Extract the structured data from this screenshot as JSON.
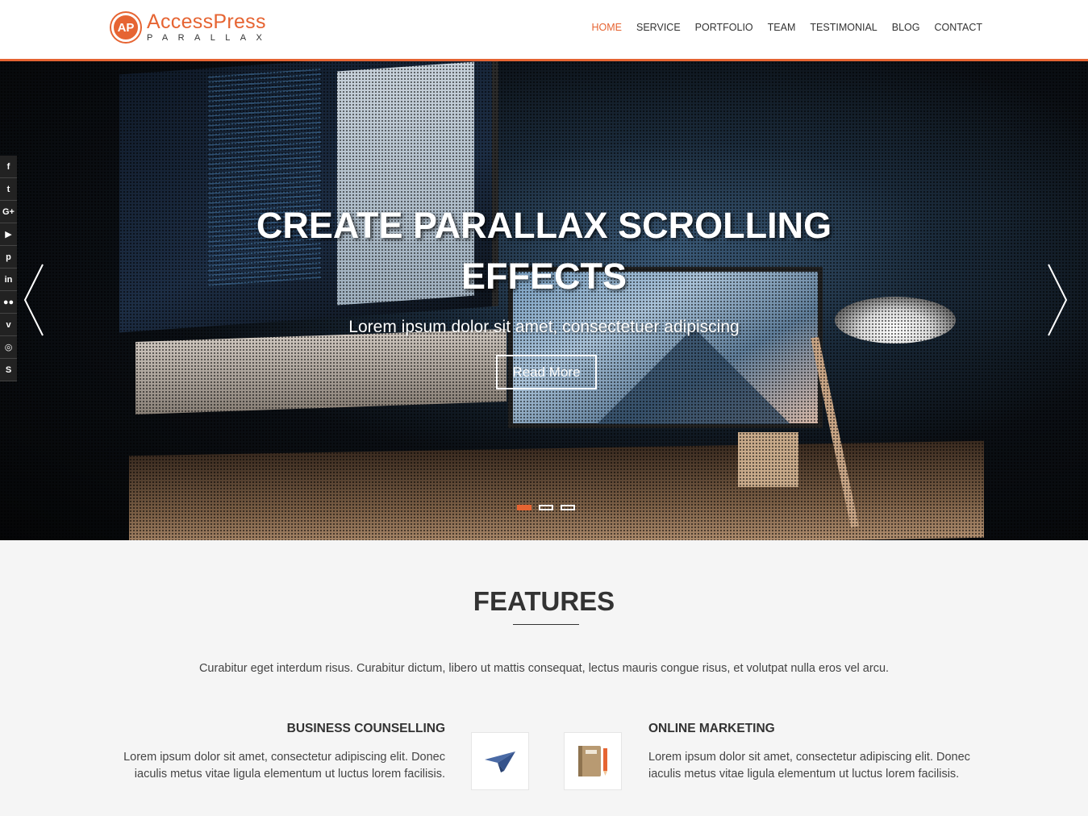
{
  "logo": {
    "badge": "AP",
    "main": "AccessPress",
    "sub": "PARALLAX"
  },
  "nav": {
    "items": [
      "HOME",
      "SERVICE",
      "PORTFOLIO",
      "TEAM",
      "TESTIMONIAL",
      "BLOG",
      "CONTACT"
    ],
    "active_index": 0
  },
  "hero": {
    "title_line1": "CREATE PARALLAX SCROLLING",
    "title_line2": "EFFECTS",
    "subtitle": "Lorem ipsum dolor sit amet, consectetuer adipiscing",
    "button_label": "Read More",
    "slides_count": 3,
    "active_slide": 0
  },
  "social": {
    "icons": [
      "facebook-icon",
      "twitter-icon",
      "google-plus-icon",
      "youtube-icon",
      "pinterest-icon",
      "linkedin-icon",
      "flickr-icon",
      "vimeo-icon",
      "instagram-icon",
      "skype-icon"
    ],
    "glyphs": [
      "f",
      "t",
      "G+",
      "▶",
      "p",
      "in",
      "●●",
      "v",
      "◎",
      "S"
    ]
  },
  "features": {
    "title": "FEATURES",
    "description": "Curabitur eget interdum risus. Curabitur dictum, libero ut mattis consequat, lectus mauris congue risus, et volutpat nulla eros vel arcu.",
    "left": {
      "title": "BUSINESS COUNSELLING",
      "text": "Lorem ipsum dolor sit amet, consectetur adipiscing elit. Donec iaculis metus vitae ligula elementum ut luctus lorem facilisis."
    },
    "right": {
      "title": "ONLINE MARKETING",
      "text": "Lorem ipsum dolor sit amet, consectetur adipiscing elit. Donec iaculis metus vitae ligula elementum ut luctus lorem facilisis."
    },
    "left_icon": "paper-plane-icon",
    "right_icon": "notebook-icon"
  },
  "colors": {
    "accent": "#e66432",
    "text": "#333333",
    "background": "#f5f5f5"
  }
}
